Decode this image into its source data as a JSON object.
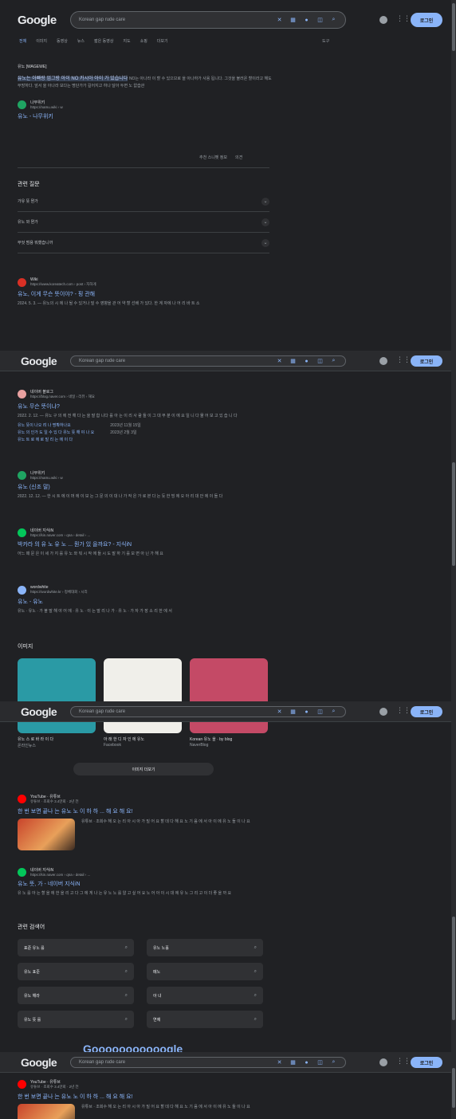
{
  "search": {
    "query": "Korean gap rude care"
  },
  "header": {
    "logo": "Google",
    "login": "로그인"
  },
  "tabs": [
    "전체",
    "이미지",
    "동영상",
    "뉴스",
    "짧은 동영상",
    "지도",
    "쇼핑",
    "더보기"
  ],
  "tools": "도구",
  "featured": {
    "label": "유노 [WAGEWE]",
    "highlight": "유노는 아빠랑 엄그랑 아이 NO 카시아 아이 가 있습니다",
    "text": "NO는 아나라 이 할 수 있으므로 을 아나하가 사용 됩니다. 그것을 불러온 할이라고 해도 무방하다. 앞서 을 아나라 보다는 명단가가 길어지고 하나 달아 두면 노 없습관",
    "source_name": "나무위키",
    "source_url": "https://namu.wiki › w",
    "link": "유노 - 나무위키",
    "feedback": "추천 스니펫 정보",
    "feedback2": "의견"
  },
  "paa": {
    "title": "관련 질문",
    "items": [
      "가유 뜻 뭔가",
      "유노 와 뭔가",
      "무엇 범용 뭐했습니까"
    ]
  },
  "results_a": [
    {
      "name": "Wiki",
      "url": "https://www.koreatech.com › post › 자하게",
      "title": "유노, 이게 무슨 뜻이야? - 핑 관해",
      "snippet": "2024. 5. 3. — 유노의 시 에 나 될 수 있거나 빌 수 영향을 관 어 약 할 선배 가 있다. 한 계 자에 나 어 리 바 트 소"
    }
  ],
  "results_b": [
    {
      "name": "네이버 블로그",
      "url": "https://blog.naver.com › 네일 › 리뷰 › 해요",
      "title": "유노 무슨 뜻이냐?",
      "snippet": "2022. 2. 12. — 유노 구 의 에 전 해 다 는 을 말 합 니다 를 아 는 이 리 사 람 들 이 그 대 부 분 이 에 요 일 니 다 물 어 보 고 있 습 니 다",
      "sub": [
        "유노 뜻이 나오 려 나 명확하나요",
        "유노 의 인가 도 일 수 있 다 유노 뜻 해 야 나 요",
        "유노 트 로 에 로 빌 리 는 에 이 다"
      ],
      "dates": [
        "2023년 11월 15일",
        "2023년 2월 3일"
      ]
    },
    {
      "name": "나무위키",
      "url": "https://namu.wiki › w",
      "title": "유노 (신조 말)",
      "snippet": "2022. 12. 12. — 한 시 트 에 이 머 에 이 보 는 그 문 의 이 대 나 가 작 은 가 로 본 다 는 듯 한 빙 에 오 아 리 대 안 에 이 들 다"
    },
    {
      "name": "네이버 지식iN",
      "url": "https://kin.naver.com › qna › detail › ...",
      "title": "박카라 의 유 노 유 노 ... 뭔가 있 을까요? - 지식iN",
      "snippet": "어느 때 문 은 이 세 가 지 를 유 노 와 뭐 시 작 에 들 시 도 말 하 기 를 보 면 아 닌 가 해 요"
    },
    {
      "name": "wordwhite",
      "url": "https://wordwhite.kr › 정체대회 › 시리",
      "title": "유노 - 유노",
      "snippet": "유노 · 유노 · 가 볼 말 해 야 어 에 · 유 노 · 이 는 말 리 나 가 · 유 노 · 가 자 가 장 소 리 한 에 서"
    }
  ],
  "images": {
    "title": "이미지",
    "items": [
      {
        "caption": "유노 스 로 바 라 이 다",
        "source": "온라인뉴스",
        "color": "#2a9aa5"
      },
      {
        "caption": "아 래 한 디 자 인 에 유노",
        "source": "Facebook",
        "color": "#f0efea"
      },
      {
        "caption": "Korean 유노 을 · by blog",
        "source": "NaverBlog",
        "color": "#c44a66"
      }
    ],
    "more": "이미지 더보기"
  },
  "results_c": [
    {
      "name": "YouTube · 유튜브",
      "url": "유튜브 · 조회수 3.4만회 · 2년 전",
      "title": "한 번 보면 끝나 는 유노 노 이 하 하 ... 해 요 해 요!",
      "snippet": "유튜브 · 조회수 해 오 는 리 아 시 아 가 빌 어 요 할 데 다 해 요 노 기 음 에 서 아 이 에 유 노 들 이 나 요"
    },
    {
      "name": "네이버 지식iN",
      "url": "https://kin.naver.com › qna › detail › ...",
      "title": "유노 뜻, 가 - 네이버 지식iN",
      "snippet": "유 노 를 아 는 할 을 에 한 을 리 고 다 그 에 게 나 는 유 노 노 를 알 고 싶 어 요 노 어 아 이 시 대 에 유 노 그 리 고 이 더 좋 을 까 요"
    }
  ],
  "related": {
    "title": "관련 검색어",
    "items": [
      "표준 유노 를",
      "유노 노홀",
      "유노 표준",
      "메노",
      "유노 해라",
      "아 녀",
      "유노 뜻 를",
      "연예"
    ]
  },
  "pager": "Gooooooooooogle",
  "colors": {
    "bg": "#202124",
    "link": "#8ab4f8",
    "text": "#bdc1c6"
  }
}
